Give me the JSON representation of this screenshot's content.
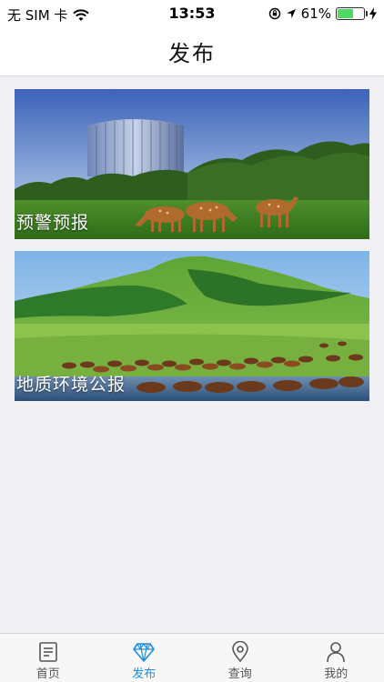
{
  "status_bar": {
    "carrier": "无 SIM 卡",
    "time": "13:53",
    "battery": "61%",
    "battery_level": 0.61
  },
  "nav": {
    "title": "发布"
  },
  "cards": [
    {
      "label": "预警预报",
      "image": "deer-grazing-photo"
    },
    {
      "label": "地质环境公报",
      "image": "grassland-horses-photo"
    }
  ],
  "tabs": [
    {
      "label": "首页",
      "icon": "news-icon",
      "active": false
    },
    {
      "label": "发布",
      "icon": "diamond-icon",
      "active": true
    },
    {
      "label": "查询",
      "icon": "location-pin-icon",
      "active": false
    },
    {
      "label": "我的",
      "icon": "person-icon",
      "active": false
    }
  ],
  "colors": {
    "accent": "#1e8ed8",
    "background": "#efeff4",
    "battery": "#4cd964"
  }
}
